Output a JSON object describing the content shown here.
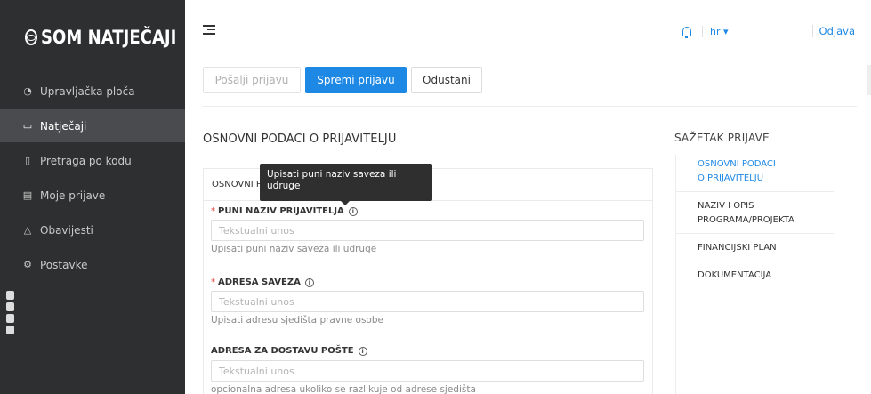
{
  "app": {
    "logo_text": "SOM NATJEČAJI"
  },
  "sidebar": {
    "items": [
      {
        "label": "Upravljačka ploča",
        "icon": "dashboard-icon",
        "active": false
      },
      {
        "label": "Natječaji",
        "icon": "folder-icon",
        "active": true
      },
      {
        "label": "Pretraga po kodu",
        "icon": "document-icon",
        "active": false
      },
      {
        "label": "Moje prijave",
        "icon": "file-icon",
        "active": false
      },
      {
        "label": "Obavijesti",
        "icon": "bell-icon",
        "active": false
      },
      {
        "label": "Postavke",
        "icon": "gear-icon",
        "active": false
      }
    ]
  },
  "header": {
    "language": "hr ▾",
    "logout": "Odjava"
  },
  "toolbar": {
    "send_label": "Pošalji prijavu",
    "save_label": "Spremi prijavu",
    "cancel_label": "Odustani"
  },
  "main": {
    "section_title": "OSNOVNI PODACI O PRIJAVITELJU",
    "card_title": "OSNOVNI PODACI O PRIJAVITELJU",
    "tooltip": "Upisati puni naziv saveza ili udruge",
    "fields": [
      {
        "label": "PUNI NAZIV PRIJAVITELJA",
        "required": true,
        "placeholder": "Tekstualni unos",
        "help": "Upisati puni naziv saveza ili udruge"
      },
      {
        "label": "ADRESA SAVEZA",
        "required": true,
        "placeholder": "Tekstualni unos",
        "help": "Upisati adresu sjedišta pravne osobe"
      },
      {
        "label": "ADRESA ZA DOSTAVU POŠTE",
        "required": false,
        "placeholder": "Tekstualni unos",
        "help": "opcionalna adresa ukoliko se razlikuje od adrese sjedišta"
      }
    ],
    "required_mark": "*",
    "info_glyph": "i"
  },
  "summary": {
    "title": "SAŽETAK PRIJAVE",
    "items": [
      {
        "label": "OSNOVNI PODACI O PRIJAVITELJU",
        "line1": "OSNOVNI PODACI",
        "line2": "O PRIJAVITELJU",
        "active": true
      },
      {
        "label": "NAZIV I OPIS PROGRAMA/PROJEKTA",
        "line1": "NAZIV I OPIS",
        "line2": "PROGRAMA/PROJEKTA",
        "active": false
      },
      {
        "label": "FINANCIJSKI PLAN",
        "line1": "FINANCIJSKI PLAN",
        "line2": "",
        "active": false
      },
      {
        "label": "DOKUMENTACIJA",
        "line1": "DOKUMENTACIJA",
        "line2": "",
        "active": false
      }
    ]
  },
  "colors": {
    "sidebar_bg": "#2e2f31",
    "sidebar_active": "#4a4b4e",
    "accent": "#1e88e5",
    "required": "#e53935"
  }
}
